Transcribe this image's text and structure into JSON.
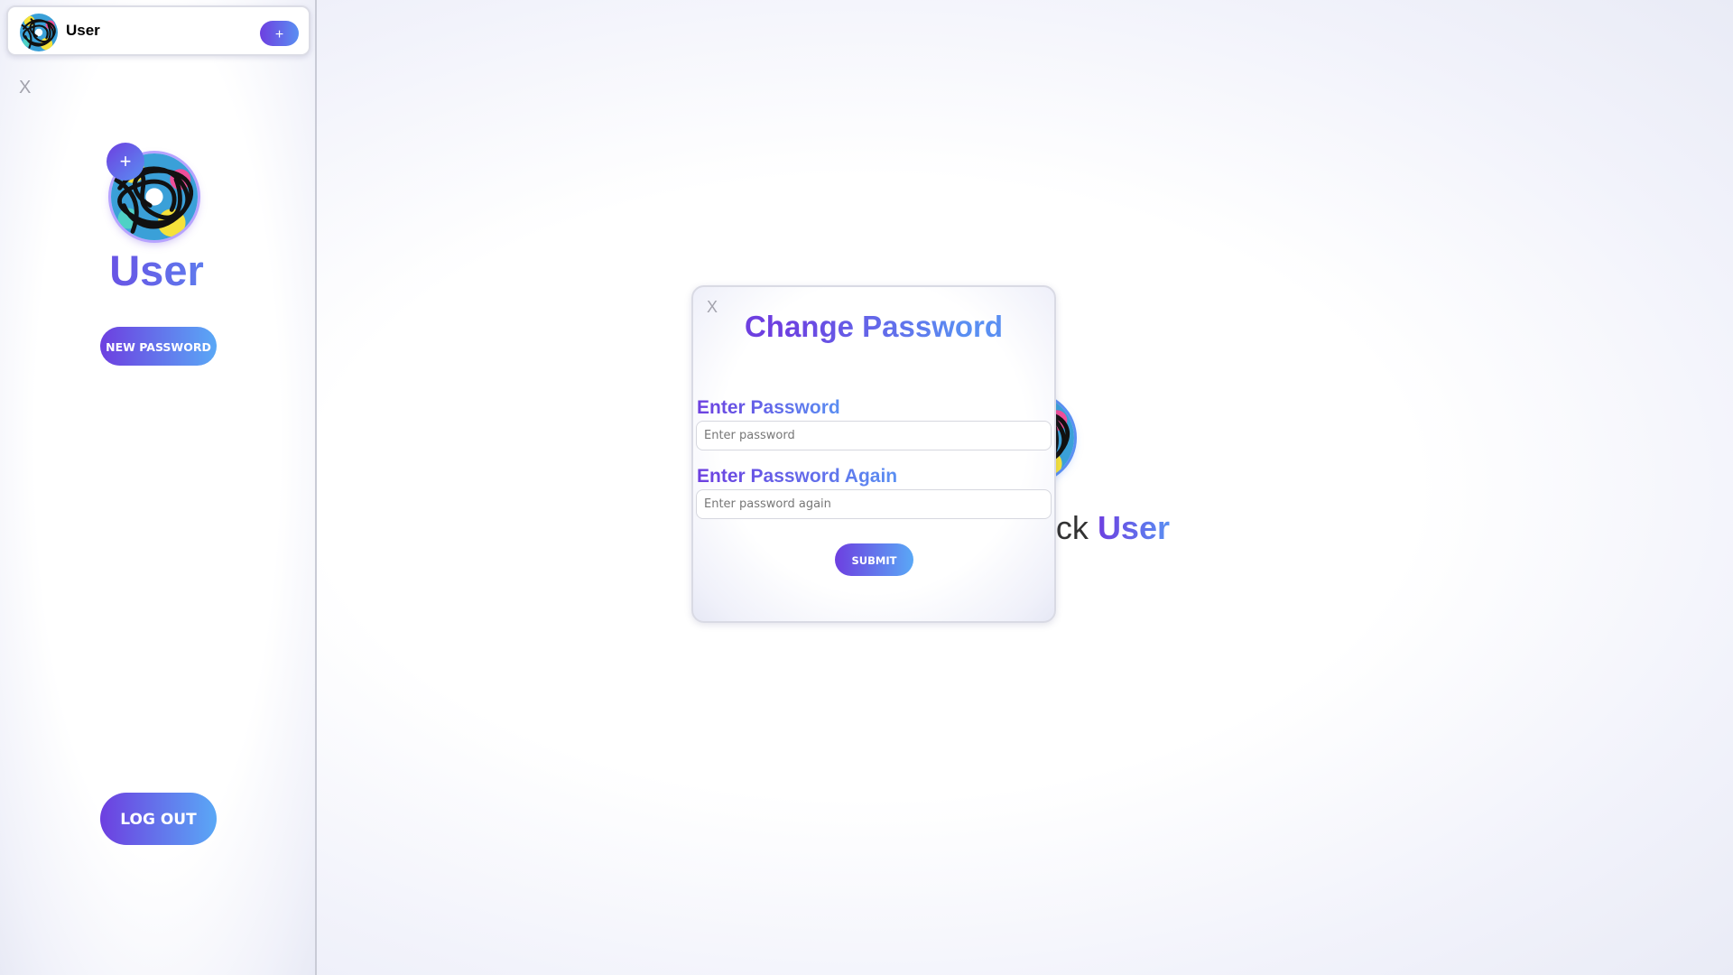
{
  "sidebar": {
    "user_name": "User",
    "add_label": "+",
    "close_label": "X",
    "profile_add_label": "+",
    "profile_name": "User",
    "new_password_label": "NEW PASSWORD",
    "logout_label": "LOG OUT"
  },
  "main": {
    "welcome_prefix": "ack",
    "welcome_user": "User"
  },
  "modal": {
    "close_label": "X",
    "title": "Change Password",
    "password_label": "Enter Password",
    "password_placeholder": "Enter password",
    "password_again_label": "Enter Password Again",
    "password_again_placeholder": "Enter password again",
    "submit_label": "SUBMIT"
  },
  "colors": {
    "accent_start": "#6d3fe0",
    "accent_end": "#5a8ff2"
  }
}
